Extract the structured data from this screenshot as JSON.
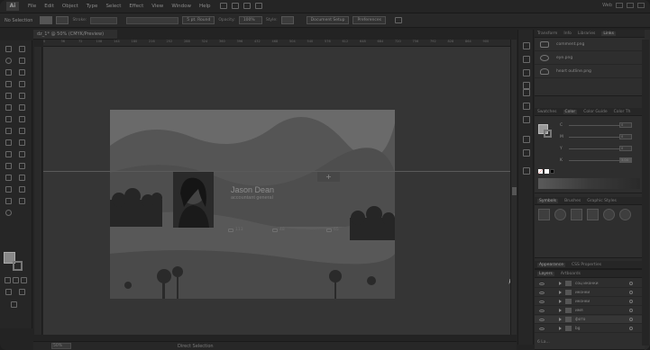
{
  "menubar": {
    "app_logo": "Ai",
    "items": [
      "File",
      "Edit",
      "Object",
      "Type",
      "Select",
      "Effect",
      "View",
      "Window",
      "Help"
    ],
    "workspace": "Web"
  },
  "control_bar": {
    "selection_label": "No Selection",
    "stroke_label": "Stroke:",
    "brush_value": "5 pt. Round",
    "opacity_label": "Opacity:",
    "opacity_value": "100%",
    "style_label": "Style:",
    "document_setup": "Document Setup",
    "preferences": "Preferences"
  },
  "document_tab": "dz_1* @ 50% (CMYK/Preview)",
  "ruler_ticks": [
    "0",
    "36",
    "72",
    "108",
    "144",
    "180",
    "216",
    "252",
    "288",
    "324",
    "360",
    "396",
    "432",
    "468",
    "504",
    "540",
    "576",
    "612",
    "648",
    "684",
    "720",
    "756",
    "792",
    "828",
    "864",
    "900"
  ],
  "artboard": {
    "name": "Jason Dean",
    "subtitle": "accountant general",
    "plus": "+",
    "stats": [
      {
        "icon": "eye-icon",
        "value": "113"
      },
      {
        "icon": "comment-icon",
        "value": "48"
      },
      {
        "icon": "heart-icon",
        "value": "65"
      }
    ]
  },
  "statusbar": {
    "zoom": "50%",
    "tool": "Direct Selection"
  },
  "links_panel": {
    "tabs": [
      "Transform",
      "Info",
      "Libraries",
      "Links"
    ],
    "active_tab": "Links",
    "items": [
      {
        "icon": "comment-icon",
        "name": "comment.png"
      },
      {
        "icon": "eye-icon",
        "name": "eye.png"
      },
      {
        "icon": "heart-icon",
        "name": "heart outline.png"
      }
    ]
  },
  "color_panel": {
    "tabs": [
      "Swatches",
      "Color",
      "Color Guide",
      "Color Th"
    ],
    "active_tab": "Color",
    "channels": [
      {
        "letter": "C",
        "value": "0"
      },
      {
        "letter": "M",
        "value": "0"
      },
      {
        "letter": "Y",
        "value": "0"
      },
      {
        "letter": "K",
        "value": "3.04"
      }
    ]
  },
  "symbols_panel": {
    "tabs": [
      "Symbols",
      "Brushes",
      "Graphic Styles"
    ],
    "active_tab": "Symbols"
  },
  "appearance_panel": {
    "tabs": [
      "Appearance",
      "CSS Properties"
    ]
  },
  "layers_panel": {
    "tabs": [
      "Layers",
      "Artboards"
    ],
    "active_tab": "Layers",
    "layers": [
      "соц иконки",
      "иконки",
      "иконки",
      "имя",
      "фото",
      "bg"
    ],
    "footer": "6 La..."
  }
}
